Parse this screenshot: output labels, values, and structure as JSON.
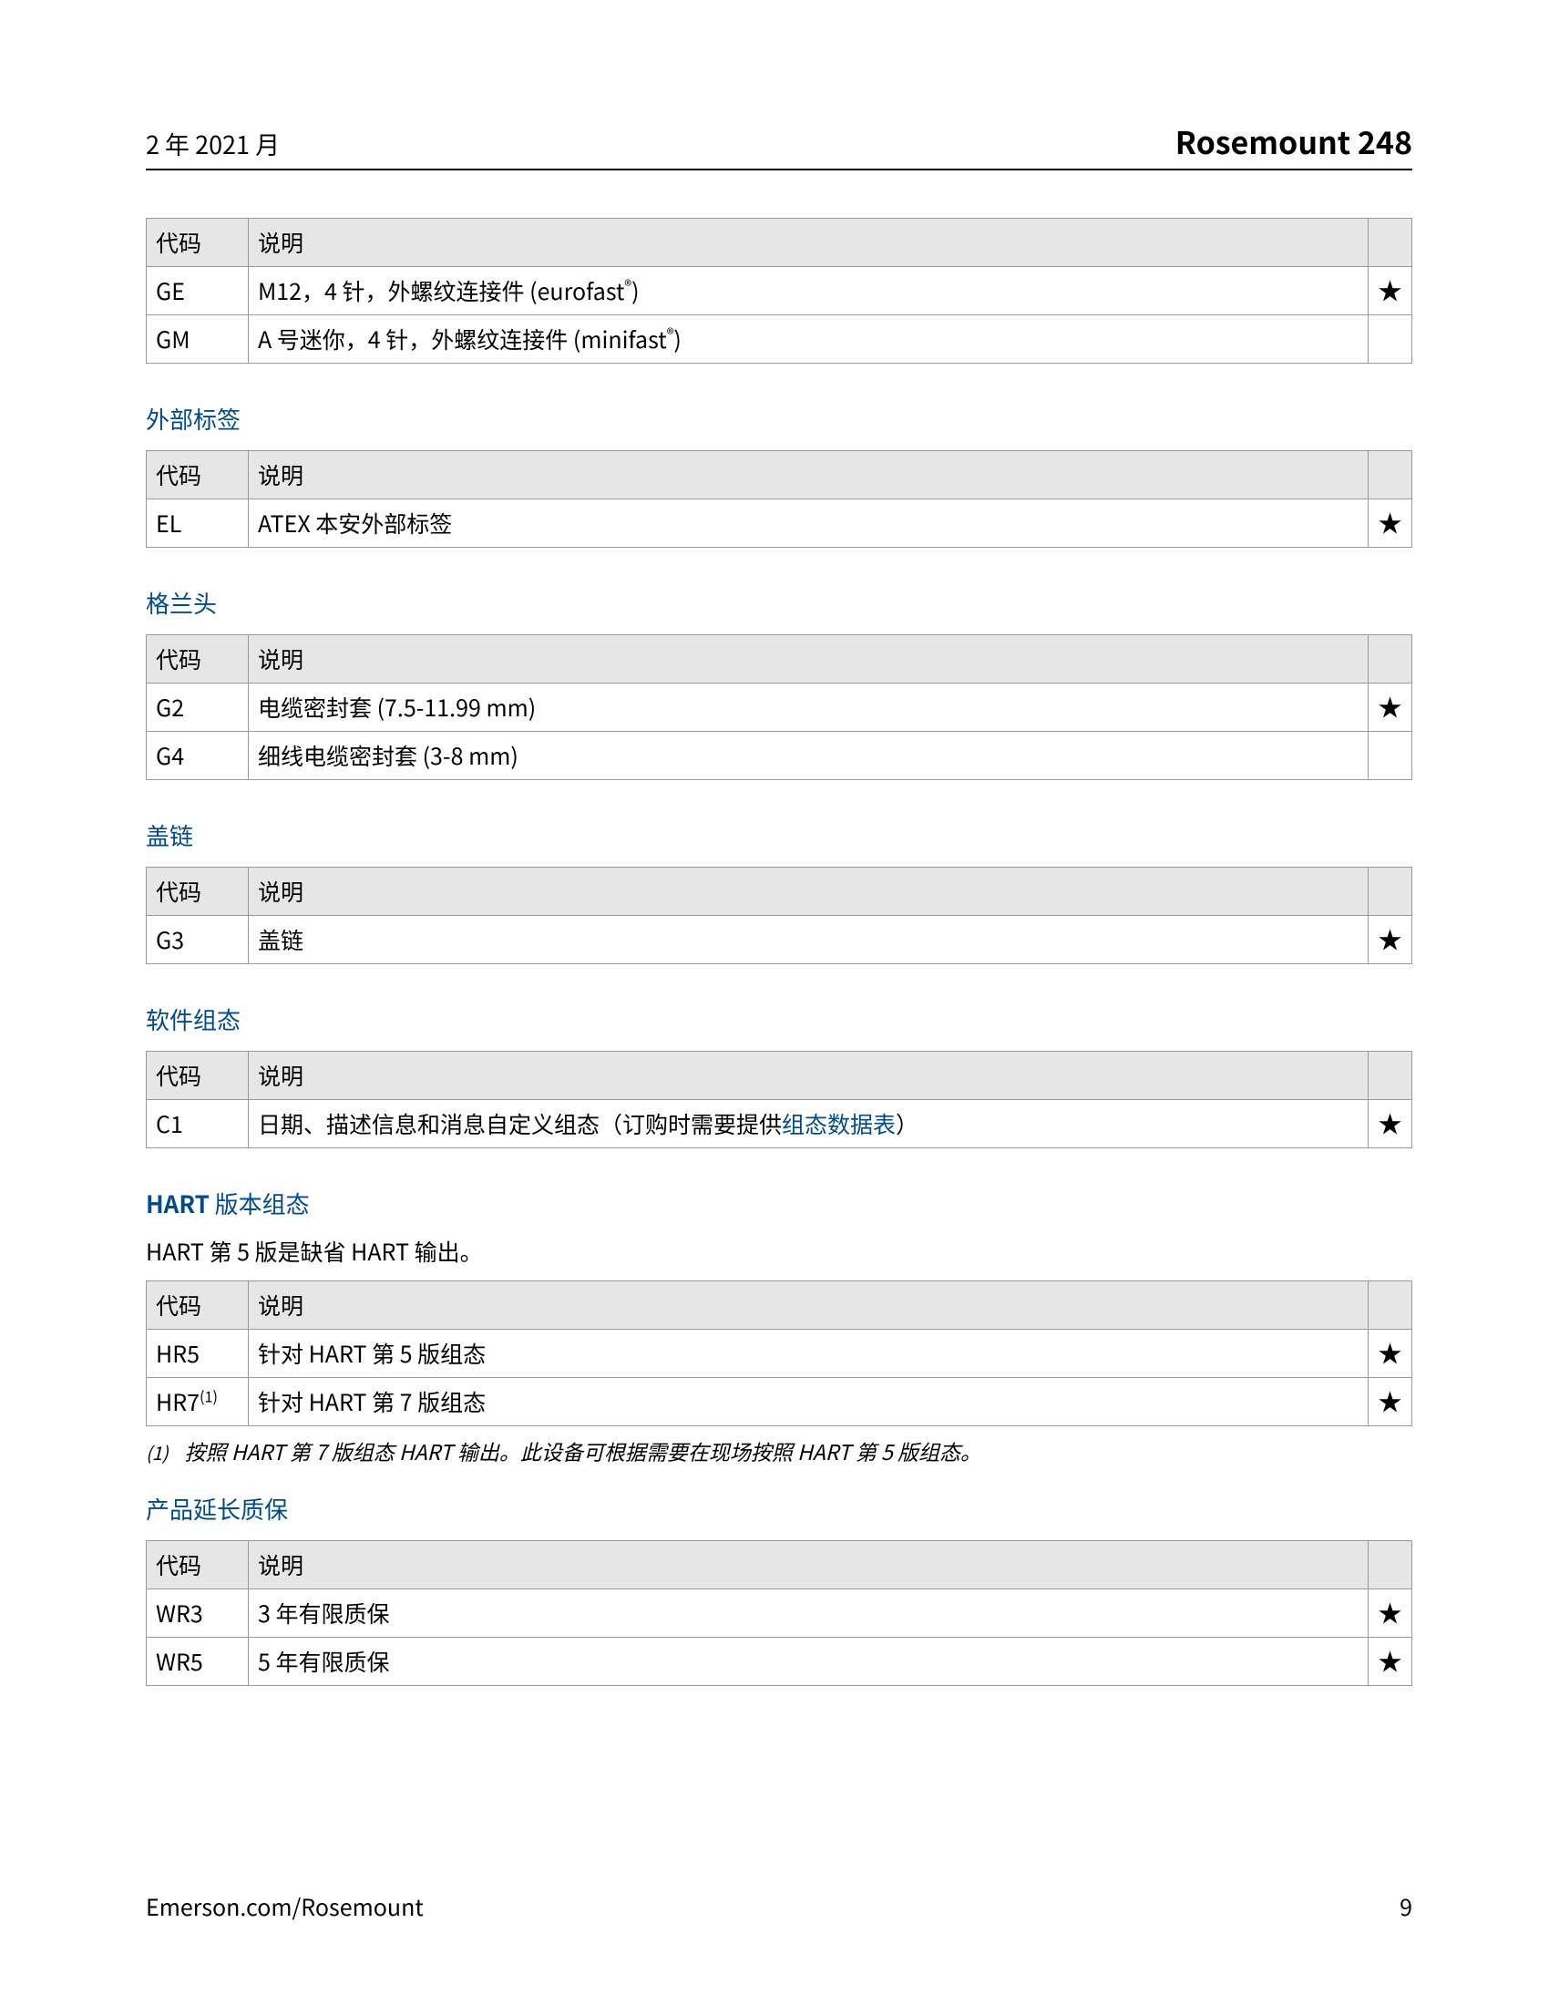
{
  "header": {
    "left": "2 年 2021 月",
    "right": "Rosemount 248"
  },
  "col_headers": {
    "code": "代码",
    "desc": "说明"
  },
  "star": "★",
  "sections": {
    "connectors": {
      "rows": {
        "r0": {
          "code": "GE",
          "desc_a": "M12，4 针，外螺纹连接件 (eurofast",
          "desc_b": ")",
          "star": "★"
        },
        "r1": {
          "code": "GM",
          "desc_a": "A 号迷你，4 针，外螺纹连接件 (minifast",
          "desc_b": ")",
          "star": ""
        }
      }
    },
    "external_label": {
      "title": "外部标签",
      "rows": {
        "r0": {
          "code": "EL",
          "desc": "ATEX 本安外部标签",
          "star": "★"
        }
      }
    },
    "gland": {
      "title": "格兰头",
      "rows": {
        "r0": {
          "code": "G2",
          "desc": "电缆密封套 (7.5-11.99 mm)",
          "star": "★"
        },
        "r1": {
          "code": "G4",
          "desc": "细线电缆密封套 (3-8 mm)",
          "star": ""
        }
      }
    },
    "cover_chain": {
      "title": "盖链",
      "rows": {
        "r0": {
          "code": "G3",
          "desc": "盖链",
          "star": "★"
        }
      }
    },
    "software": {
      "title": "软件组态",
      "rows": {
        "r0": {
          "code": "C1",
          "desc_a": "日期、描述信息和消息自定义组态（订购时需要提供",
          "link": "组态数据表",
          "desc_b": "）",
          "star": "★"
        }
      }
    },
    "hart": {
      "title_bold": "HART",
      "title_rest": " 版本组态",
      "subnote": "HART 第 5 版是缺省 HART 输出。",
      "rows": {
        "r0": {
          "code": "HR5",
          "desc": "针对 HART 第 5 版组态",
          "star": "★"
        },
        "r1": {
          "code_a": "HR7",
          "fn": "(1)",
          "desc": "针对 HART 第 7 版组态",
          "star": "★"
        }
      },
      "footnote": {
        "idx": "(1)",
        "text": "按照 HART 第 7 版组态 HART 输出。此设备可根据需要在现场按照 HART 第 5 版组态。"
      }
    },
    "warranty": {
      "title": "产品延长质保",
      "rows": {
        "r0": {
          "code": "WR3",
          "desc": "3 年有限质保",
          "star": "★"
        },
        "r1": {
          "code": "WR5",
          "desc": "5 年有限质保",
          "star": "★"
        }
      }
    }
  },
  "footer": {
    "left": "Emerson.com/Rosemount",
    "right": "9"
  }
}
